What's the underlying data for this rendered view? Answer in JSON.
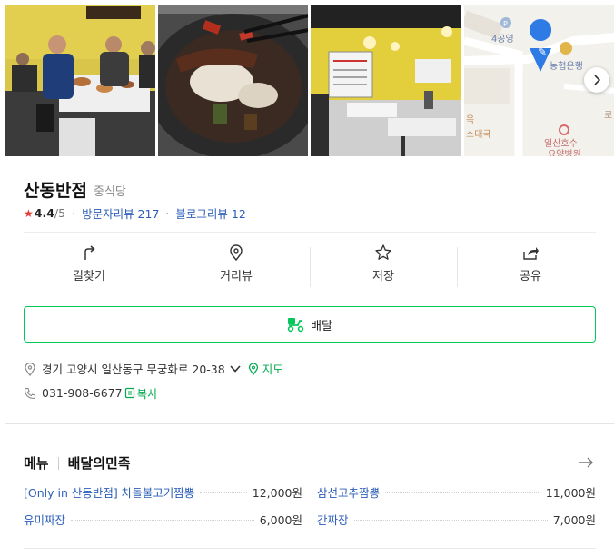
{
  "place": {
    "name": "산동반점",
    "category": "중식당"
  },
  "rating": {
    "star": "★",
    "value": "4.4",
    "max": "/5",
    "visitor_reviews": "방문자리뷰 217",
    "blog_reviews": "블로그리뷰 12"
  },
  "photos": {
    "map_labels": [
      "4공영",
      "농협은행",
      "일산호수",
      "요양병원",
      "옥",
      "소대국",
      "로"
    ]
  },
  "actions": [
    {
      "label": "길찾기",
      "icon": "directions-icon"
    },
    {
      "label": "거리뷰",
      "icon": "location-pin-icon"
    },
    {
      "label": "저장",
      "icon": "star-icon"
    },
    {
      "label": "공유",
      "icon": "share-icon"
    }
  ],
  "delivery": {
    "label": "배달",
    "icon": "delivery-scooter-icon"
  },
  "info": {
    "address": "경기 고양시 일산동구 무궁화로 20-38",
    "map_link": "지도",
    "phone": "031-908-6677",
    "copy": "복사"
  },
  "menu": {
    "title": "메뉴",
    "provider": "배달의민족",
    "items": [
      {
        "name": "[Only in 산동반점] 차돌불고기짬뽕",
        "price": "12,000원"
      },
      {
        "name": "삼선고추짬뽕",
        "price": "11,000원"
      },
      {
        "name": "유미짜장",
        "price": "6,000원"
      },
      {
        "name": "간짜장",
        "price": "7,000원"
      }
    ]
  },
  "colors": {
    "accent_green": "#03c75a",
    "link_blue": "#2c5eb8",
    "star_red": "#e53935"
  }
}
